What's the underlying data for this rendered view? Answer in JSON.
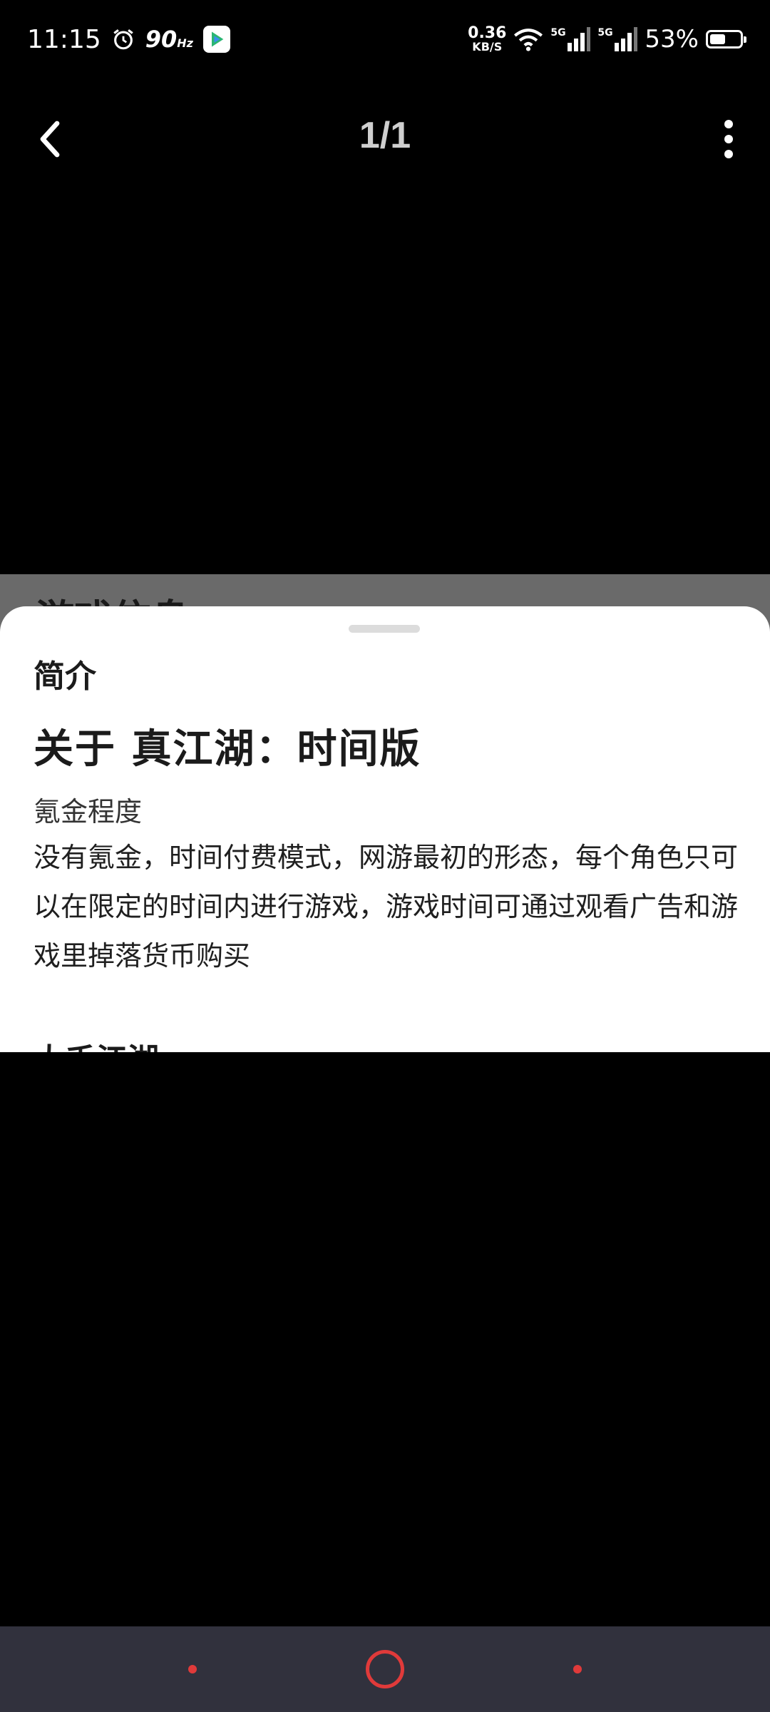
{
  "status_bar": {
    "time": "11:15",
    "refresh_rate": "90",
    "refresh_unit": "Hz",
    "net_speed_value": "0.36",
    "net_speed_unit": "KB/S",
    "sim1_label": "5G",
    "sim2_label": "5G",
    "battery_percent_text": "53%",
    "battery_level": 0.53
  },
  "nav": {
    "page_counter": "1/1"
  },
  "background": {
    "peek_text": "游戏信息"
  },
  "sheet": {
    "title": "简介",
    "heading": "关于 真江湖：时间版",
    "subheading": "氪金程度",
    "body": "没有氪金，时间付费模式，网游最初的形态，每个角色只可以在限定的时间内进行游戏，游戏时间可通过观看广告和游戏里掉落货币购买",
    "next_section": "大千江湖"
  },
  "colors": {
    "accent": "#e03a3a",
    "bottom_nav_bg": "#31313d",
    "overlay": "#6a6a6a"
  }
}
